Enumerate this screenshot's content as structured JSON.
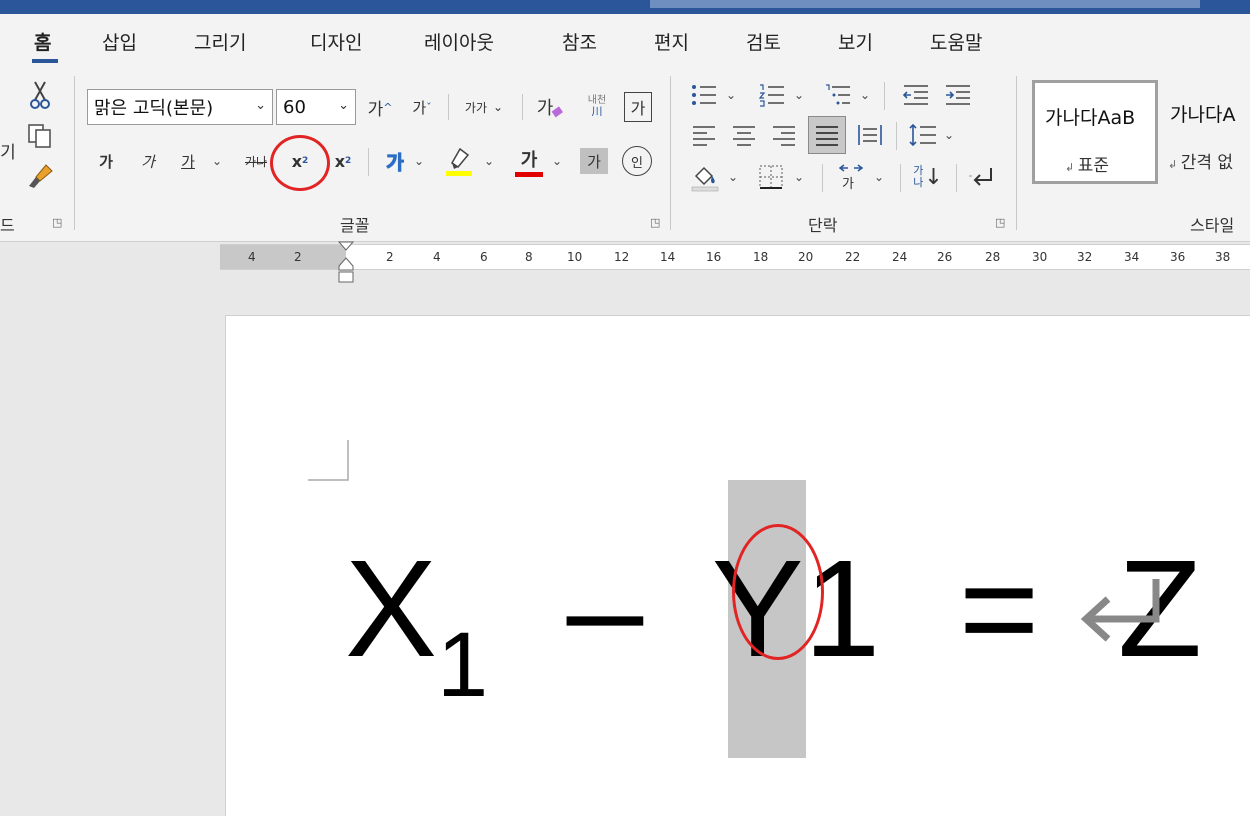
{
  "menu_tabs": [
    "홈",
    "삽입",
    "그리기",
    "디자인",
    "레이아웃",
    "참조",
    "편지",
    "검토",
    "보기",
    "도움말"
  ],
  "clipboard": {
    "cut_label": "X",
    "label_left": "기",
    "group_label": "드"
  },
  "font_group": {
    "font_name": "맑은 고딕(본문)",
    "font_size": "60",
    "grow_label": "가",
    "shrink_label": "가",
    "change_case_label": "가가",
    "clear_format_label": "가",
    "phonetic_label": "내천",
    "phonetic_sub": "川",
    "char_border_label": "가",
    "bold_label": "가",
    "italic_label": "가",
    "underline_label": "가",
    "strike_label": "가나",
    "subscript_label": "x",
    "subscript_small": "2",
    "superscript_label": "x",
    "superscript_small": "2",
    "effects_label": "가",
    "font_color_label": "가",
    "shading_label": "가",
    "enclose_label": "인",
    "group_label": "글꼴"
  },
  "paragraph_group": {
    "group_label": "단락",
    "sort_label": "가",
    "sort_sub": "나"
  },
  "styles_group": {
    "group_label": "스타일",
    "styles": [
      {
        "sample": "가나다AaB",
        "name": "표준"
      },
      {
        "sample": "가나다A",
        "name": "간격 없"
      }
    ]
  },
  "ruler": {
    "left_labels": [
      "4",
      "2"
    ],
    "right_labels": [
      "2",
      "4",
      "6",
      "8",
      "10",
      "12",
      "14",
      "16",
      "18",
      "20",
      "22",
      "24",
      "26",
      "28",
      "30",
      "32",
      "34",
      "36",
      "38"
    ]
  },
  "document": {
    "x_char": "X",
    "x_sub": "1",
    "minus": "–",
    "y_char": "Y",
    "selected_digit": "1",
    "equals": "=",
    "z_char": "Z"
  },
  "colors": {
    "accent": "#2b579a",
    "annotation": "#e12424",
    "highlight_yellow": "#ffff00",
    "font_color_red": "#e00000",
    "selection_grey": "#c6c6c6"
  }
}
